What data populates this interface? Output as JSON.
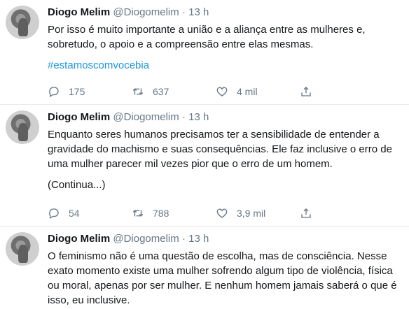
{
  "tweets": [
    {
      "name": "Diogo Melim",
      "handle": "@Diogomelim",
      "separator": "·",
      "time": "13 h",
      "text": "Por isso é muito importante a união e a aliança entre as mulheres e, sobretudo, o apoio e a compreensão entre elas mesmas.",
      "hashtag": "#estamoscomvocebia",
      "replies": "175",
      "retweets": "637",
      "likes": "4 mil"
    },
    {
      "name": "Diogo Melim",
      "handle": "@Diogomelim",
      "separator": "·",
      "time": "13 h",
      "text": "Enquanto seres humanos precisamos ter a sensibilidade de entender a gravidade do machismo e suas consequências. Ele faz inclusive o erro de uma mulher parecer mil vezes pior que o erro de um homem.",
      "more": "(Continua...)",
      "replies": "54",
      "retweets": "788",
      "likes": "3,9 mil"
    },
    {
      "name": "Diogo Melim",
      "handle": "@Diogomelim",
      "separator": "·",
      "time": "13 h",
      "text": "O feminismo não é uma questão de escolha, mas de consciência. Nesse exato momento existe uma mulher sofrendo algum tipo de violência, física ou moral, apenas por ser mulher. E nenhum homem jamais saberá o que é isso, eu inclusive."
    }
  ],
  "icons": {
    "reply": "reply-icon",
    "retweet": "retweet-icon",
    "like": "heart-icon",
    "share": "share-icon"
  },
  "colors": {
    "text": "#14171a",
    "muted": "#657786",
    "link": "#1b95e0",
    "divider": "#e6ecf0"
  }
}
